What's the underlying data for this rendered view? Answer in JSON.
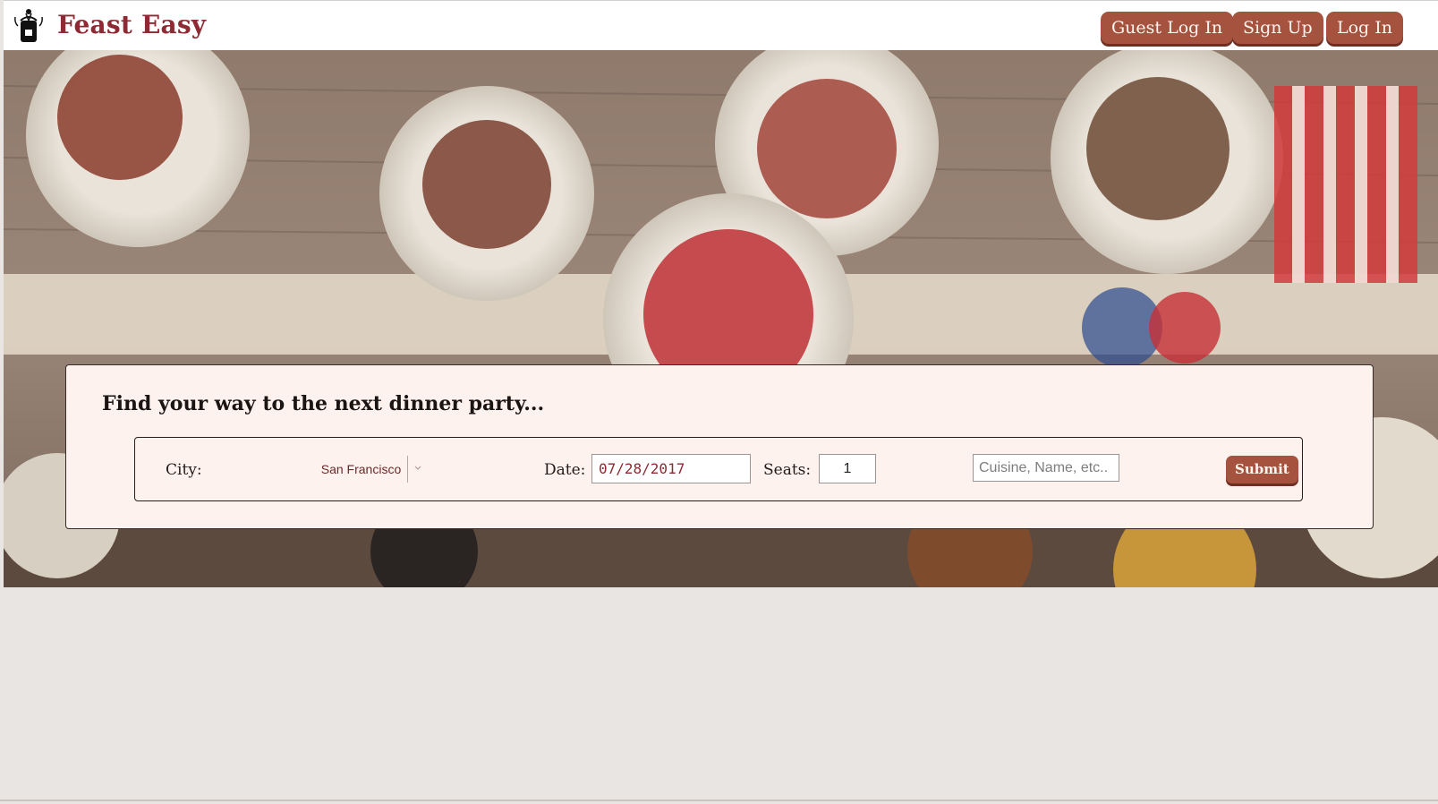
{
  "header": {
    "brand": "Feast Easy",
    "logo_icon": "apron-chef-icon",
    "buttons": {
      "guest_login": "Guest Log In",
      "sign_up": "Sign Up",
      "log_in": "Log In"
    }
  },
  "hero": {
    "image": "dinner-table-photo"
  },
  "search": {
    "title": "Find your way to the next dinner party...",
    "city_label": "City:",
    "city_value": "San Francisco",
    "date_label": "Date:",
    "date_value": "07/28/2017",
    "seats_label": "Seats:",
    "seats_value": "1",
    "query_placeholder": "Cuisine, Name, etc..",
    "submit_label": "Submit"
  },
  "colors": {
    "brand": "#8e2a33",
    "button": "#a5523f",
    "panel": "#fdf2ee",
    "page_bg": "#e8e5e2"
  }
}
